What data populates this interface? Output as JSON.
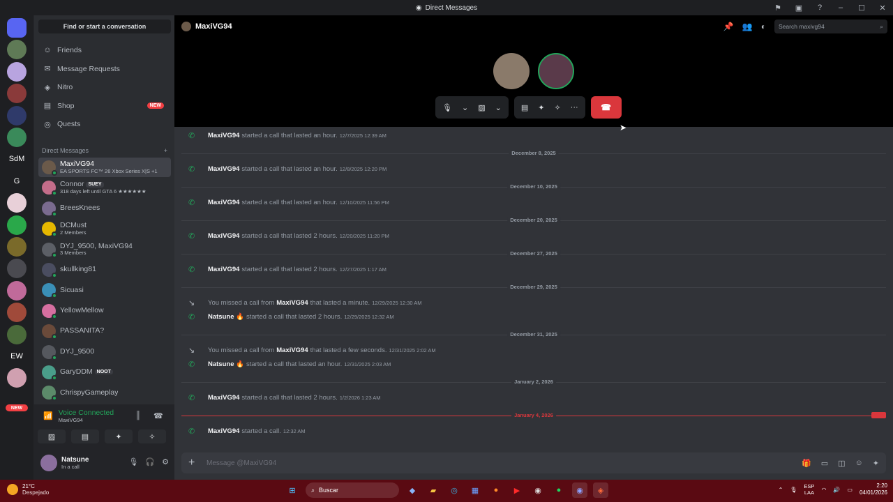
{
  "window": {
    "title": "Direct Messages"
  },
  "sidebar": {
    "search_label": "Find or start a conversation",
    "nav": [
      {
        "label": "Friends",
        "icon": "friends-icon"
      },
      {
        "label": "Message Requests",
        "icon": "mail-icon"
      },
      {
        "label": "Nitro",
        "icon": "nitro-icon"
      },
      {
        "label": "Shop",
        "icon": "shop-icon",
        "badge": "NEW"
      },
      {
        "label": "Quests",
        "icon": "quests-icon"
      }
    ],
    "dm_header": "Direct Messages",
    "dms": [
      {
        "name": "MaxiVG94",
        "sub": "EA SPORTS FC™ 26 Xbox Series X|S +1",
        "active": true,
        "color": "#6b5a4a"
      },
      {
        "name": "Connor",
        "tag": "SUEY",
        "sub": "318 days left until GTA 6 ★★★★★★",
        "color": "#c46d8a"
      },
      {
        "name": "BreesKnees",
        "sub": "",
        "color": "#7a6b8f"
      },
      {
        "name": "DCMust",
        "sub": "2 Members",
        "color": "#e6b800"
      },
      {
        "name": "DYJ_9500, MaxiVG94",
        "sub": "3 Members",
        "color": "#5c5f66"
      },
      {
        "name": "skullking81",
        "sub": "",
        "color": "#4a4d60"
      },
      {
        "name": "Sicuasi",
        "sub": "",
        "color": "#3a8fb7"
      },
      {
        "name": "YellowMellow",
        "sub": "",
        "color": "#d66fa0"
      },
      {
        "name": "PASSANITA?",
        "sub": "",
        "color": "#6a4a3a"
      },
      {
        "name": "DYJ_9500",
        "sub": "",
        "color": "#55585e"
      },
      {
        "name": "GaryDDM",
        "tag": "NOOT",
        "sub": "",
        "color": "#4a9e8a"
      },
      {
        "name": "ChrispyGameplay",
        "sub": "",
        "color": "#5c8a6a"
      }
    ]
  },
  "rail": {
    "servers": [
      {
        "label": "",
        "color": "#5865f2"
      },
      {
        "label": "",
        "color": "#5f7a56"
      },
      {
        "label": "",
        "color": "#b8a4e0"
      },
      {
        "label": "",
        "color": "#8a3a3a"
      },
      {
        "label": "",
        "color": "#2f3a6a"
      },
      {
        "label": "",
        "color": "#3a8a5a"
      },
      {
        "label": "SdM",
        "color": ""
      },
      {
        "label": "G",
        "color": ""
      },
      {
        "label": "",
        "color": "#e8d0d8"
      },
      {
        "label": "",
        "color": "#2aa84a"
      },
      {
        "label": "",
        "color": "#7a6a2a"
      },
      {
        "label": "",
        "color": "#4a4a50"
      },
      {
        "label": "",
        "color": "#c06a9a"
      },
      {
        "label": "",
        "color": "#a04a3a"
      },
      {
        "label": "",
        "color": "#4a6a3a"
      },
      {
        "label": "EW",
        "color": ""
      },
      {
        "label": "",
        "color": "#d0a0b0"
      }
    ],
    "new_badge": "NEW"
  },
  "voice": {
    "status": "Voice Connected",
    "channel": "MaxiVG94"
  },
  "user": {
    "name": "Natsune",
    "status": "In a call"
  },
  "header": {
    "channel": "MaxiVG94",
    "search_placeholder": "Search maxivg94"
  },
  "messages": [
    {
      "type": "call",
      "user": "MaxiVG94",
      "text": "started a call that lasted an hour.",
      "ts": "12/7/2025 12:39 AM"
    },
    {
      "type": "divider",
      "label": "December 8, 2025"
    },
    {
      "type": "call",
      "user": "MaxiVG94",
      "text": "started a call that lasted an hour.",
      "ts": "12/8/2025 12:20 PM"
    },
    {
      "type": "divider",
      "label": "December 10, 2025"
    },
    {
      "type": "call",
      "user": "MaxiVG94",
      "text": "started a call that lasted an hour.",
      "ts": "12/10/2025 11:56 PM"
    },
    {
      "type": "divider",
      "label": "December 20, 2025"
    },
    {
      "type": "call",
      "user": "MaxiVG94",
      "text": "started a call that lasted 2 hours.",
      "ts": "12/20/2025 11:20 PM"
    },
    {
      "type": "divider",
      "label": "December 27, 2025"
    },
    {
      "type": "call",
      "user": "MaxiVG94",
      "text": "started a call that lasted 2 hours.",
      "ts": "12/27/2025 1:17 AM"
    },
    {
      "type": "divider",
      "label": "December 29, 2025"
    },
    {
      "type": "missed",
      "prefix": "You missed a call from",
      "user": "MaxiVG94",
      "text": "that lasted a minute.",
      "ts": "12/29/2025 12:30 AM"
    },
    {
      "type": "call",
      "user": "Natsune 🔥",
      "text": "started a call that lasted 2 hours.",
      "ts": "12/29/2025 12:32 AM"
    },
    {
      "type": "divider",
      "label": "December 31, 2025"
    },
    {
      "type": "missed",
      "prefix": "You missed a call from",
      "user": "MaxiVG94",
      "text": "that lasted a few seconds.",
      "ts": "12/31/2025 2:02 AM"
    },
    {
      "type": "call",
      "user": "Natsune 🔥",
      "text": "started a call that lasted an hour.",
      "ts": "12/31/2025 2:03 AM"
    },
    {
      "type": "divider",
      "label": "January 2, 2026"
    },
    {
      "type": "call",
      "user": "MaxiVG94",
      "text": "started a call that lasted 2 hours.",
      "ts": "1/2/2026 1:23 AM"
    },
    {
      "type": "newdivider",
      "label": "January 4, 2026",
      "badge": "NEW"
    },
    {
      "type": "call",
      "user": "MaxiVG94",
      "text": "started a call.",
      "ts": "12:32 AM"
    }
  ],
  "composer": {
    "placeholder": "Message @MaxiVG94"
  },
  "taskbar": {
    "temp": "21°C",
    "weather": "Despejado",
    "search": "Buscar",
    "lang1": "ESP",
    "lang2": "LAA",
    "time": "2:20",
    "date": "04/01/2026"
  }
}
